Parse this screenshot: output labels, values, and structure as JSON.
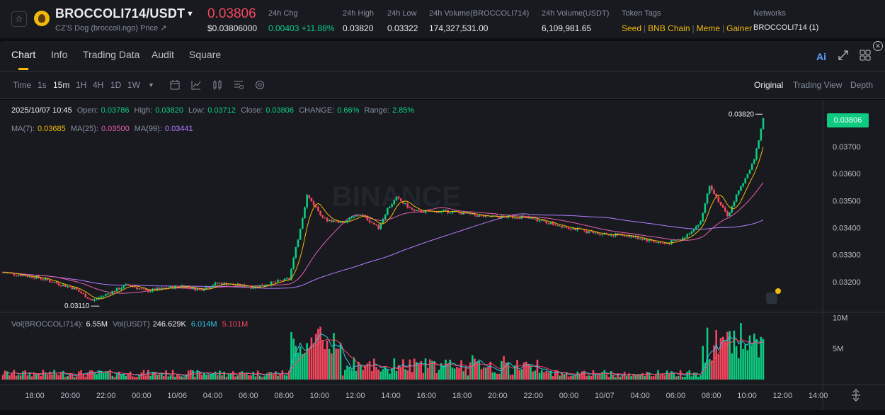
{
  "header": {
    "pair": "BROCCOLI714/USDT",
    "subtitle": "CZ'S Dog (broccoli.ngo) Price ↗",
    "last_price": "0.03806",
    "last_price_usd": "$0.03806000",
    "stats": [
      {
        "label": "24h Chg",
        "value": "0.00403 +11.88%",
        "positive": true
      },
      {
        "label": "24h High",
        "value": "0.03820"
      },
      {
        "label": "24h Low",
        "value": "0.03322"
      },
      {
        "label": "24h Volume(BROCCOLI714)",
        "value": "174,327,531.00"
      },
      {
        "label": "24h Volume(USDT)",
        "value": "6,109,981.65"
      }
    ],
    "token_tags_label": "Token Tags",
    "token_tags": [
      "Seed",
      "BNB Chain",
      "Meme",
      "Gainer"
    ],
    "networks_label": "Networks",
    "networks_value": "BROCCOLI714 (1)"
  },
  "tabs": [
    "Chart",
    "Info",
    "Trading Data",
    "Audit",
    "Square"
  ],
  "ai_label": "Ai",
  "toolbar": {
    "time_label": "Time",
    "intervals": [
      "1s",
      "15m",
      "1H",
      "4H",
      "1D",
      "1W"
    ],
    "active_interval": "15m",
    "views": [
      "Original",
      "Trading View",
      "Depth"
    ],
    "active_view": "Original"
  },
  "ohlc": {
    "date": "2025/10/07 10:45",
    "open_label": "Open:",
    "open": "0.03786",
    "high_label": "High:",
    "high": "0.03820",
    "low_label": "Low:",
    "low": "0.03712",
    "close_label": "Close:",
    "close": "0.03806",
    "change_label": "CHANGE:",
    "change": "0.66%",
    "range_label": "Range:",
    "range": "2.85%"
  },
  "ma": {
    "ma7_label": "MA(7):",
    "ma7": "0.03685",
    "ma25_label": "MA(25):",
    "ma25": "0.03500",
    "ma99_label": "MA(99):",
    "ma99": "0.03441"
  },
  "vol": {
    "label": "Vol(BROCCOLI714):",
    "value": "6.55M",
    "usdt_label": "Vol(USDT)",
    "usdt_value": "246.629K",
    "ma1": "6.014M",
    "ma2": "5.101M"
  },
  "watermark": "BINANCE",
  "current_price_tag": "0.03806",
  "high_marker": "0.03820",
  "low_marker": "0.03110",
  "colors": {
    "up": "#0ecb81",
    "down": "#f6465d",
    "accent": "#f0b90b",
    "ma7": "#f0b90b",
    "ma25": "#e65fb0",
    "ma99": "#b67cff",
    "vol_ma1": "#2ec6e6"
  },
  "chart_data": {
    "type": "candlestick",
    "price_axis_ticks": [
      "0.03700",
      "0.03600",
      "0.03500",
      "0.03400",
      "0.03300",
      "0.03200"
    ],
    "price_range": [
      0.031,
      0.0386
    ],
    "volume_axis_ticks": [
      "10M",
      "5M"
    ],
    "time_ticks": [
      "18:00",
      "20:00",
      "22:00",
      "00:00",
      "10/06",
      "04:00",
      "06:00",
      "08:00",
      "10:00",
      "12:00",
      "14:00",
      "16:00",
      "18:00",
      "20:00",
      "22:00",
      "00:00",
      "10/07",
      "04:00",
      "06:00",
      "08:00",
      "10:00",
      "12:00",
      "14:00"
    ],
    "close_path": [
      {
        "h": 0,
        "p": 0.03235
      },
      {
        "h": 4,
        "p": 0.03215
      },
      {
        "h": 8,
        "p": 0.03175
      },
      {
        "h": 10,
        "p": 0.0313
      },
      {
        "h": 14,
        "p": 0.0319
      },
      {
        "h": 16,
        "p": 0.03165
      },
      {
        "h": 20,
        "p": 0.03185
      },
      {
        "h": 22,
        "p": 0.0317
      },
      {
        "h": 24,
        "p": 0.03195
      },
      {
        "h": 28,
        "p": 0.0318
      },
      {
        "h": 32,
        "p": 0.0321
      },
      {
        "h": 33,
        "p": 0.0336
      },
      {
        "h": 34,
        "p": 0.0352
      },
      {
        "h": 36,
        "p": 0.0343
      },
      {
        "h": 38,
        "p": 0.0342
      },
      {
        "h": 40,
        "p": 0.0345
      },
      {
        "h": 42,
        "p": 0.034
      },
      {
        "h": 43,
        "p": 0.0347
      },
      {
        "h": 44,
        "p": 0.0351
      },
      {
        "h": 46,
        "p": 0.0346
      },
      {
        "h": 50,
        "p": 0.0346
      },
      {
        "h": 54,
        "p": 0.0344
      },
      {
        "h": 58,
        "p": 0.0344
      },
      {
        "h": 62,
        "p": 0.0341
      },
      {
        "h": 66,
        "p": 0.0338
      },
      {
        "h": 70,
        "p": 0.0337
      },
      {
        "h": 74,
        "p": 0.0334
      },
      {
        "h": 76,
        "p": 0.0336
      },
      {
        "h": 78,
        "p": 0.0342
      },
      {
        "h": 79,
        "p": 0.0356
      },
      {
        "h": 80,
        "p": 0.035
      },
      {
        "h": 81,
        "p": 0.0344
      },
      {
        "h": 82,
        "p": 0.0352
      },
      {
        "h": 83,
        "p": 0.0358
      },
      {
        "h": 84,
        "p": 0.0365
      },
      {
        "h": 85,
        "p": 0.03806
      }
    ],
    "ma_series": [
      "MA(7)",
      "MA(25)",
      "MA(99)"
    ]
  }
}
